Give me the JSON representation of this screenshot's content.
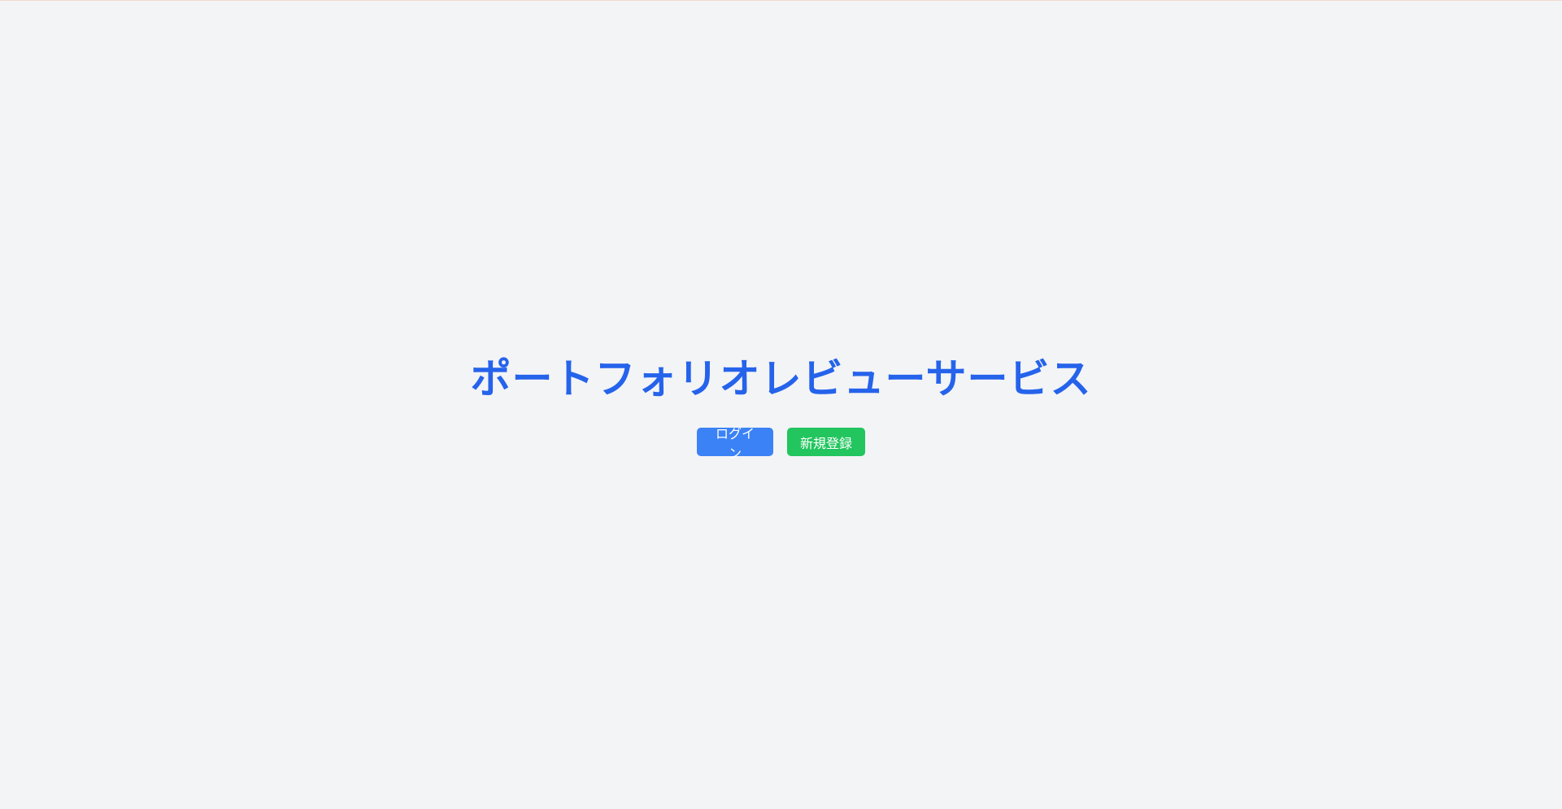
{
  "hero": {
    "title": "ポートフォリオレビューサービス",
    "login_label": "ログイン",
    "register_label": "新規登録"
  },
  "colors": {
    "background": "#f3f4f6",
    "title": "#2563eb",
    "login_button": "#3b82f6",
    "register_button": "#22c55e"
  }
}
